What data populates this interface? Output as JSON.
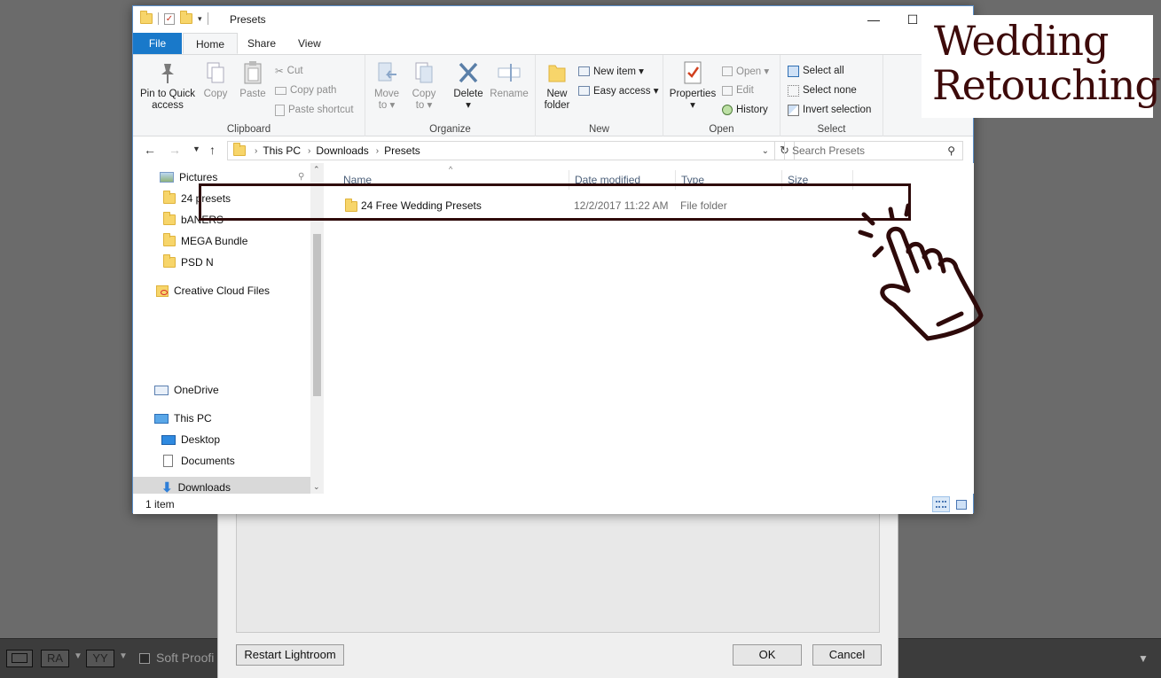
{
  "window": {
    "title": "Presets",
    "minimize_glyph": "—",
    "maximize_glyph": "☐",
    "close_glyph": "✕"
  },
  "ribbon_tabs": [
    "File",
    "Home",
    "Share",
    "View"
  ],
  "clipboard": {
    "pin_label": "Pin to Quick\naccess",
    "copy": "Copy",
    "paste": "Paste",
    "cut": "Cut",
    "copy_path": "Copy path",
    "paste_shortcut": "Paste shortcut",
    "group": "Clipboard"
  },
  "organize": {
    "move_to": "Move\nto ▾",
    "copy_to": "Copy\nto ▾",
    "delete": "Delete\n▾",
    "rename": "Rename",
    "group": "Organize"
  },
  "new_group": {
    "new_folder": "New\nfolder",
    "new_item": "New item ▾",
    "easy_access": "Easy access ▾",
    "group": "New"
  },
  "open_group": {
    "properties": "Properties\n▾",
    "open": "Open ▾",
    "edit": "Edit",
    "history": "History",
    "group": "Open"
  },
  "select_group": {
    "select_all": "Select all",
    "select_none": "Select none",
    "invert_selection": "Invert selection",
    "group": "Select"
  },
  "address": {
    "crumbs": [
      "This PC",
      "Downloads",
      "Presets"
    ],
    "search_placeholder": "Search Presets"
  },
  "nav": {
    "items": [
      {
        "label": "Pictures"
      },
      {
        "label": "24 presets"
      },
      {
        "label": "bANERS"
      },
      {
        "label": "MEGA Bundle"
      },
      {
        "label": "PSD N"
      },
      {
        "label": "Creative Cloud Files"
      },
      {
        "label": "OneDrive"
      },
      {
        "label": "This PC"
      },
      {
        "label": "Desktop"
      },
      {
        "label": "Documents"
      },
      {
        "label": "Downloads"
      }
    ]
  },
  "columns": [
    "Name",
    "Date modified",
    "Type",
    "Size"
  ],
  "files": [
    {
      "name": "24 Free Wedding Presets",
      "date": "12/2/2017 11:22 AM",
      "type": "File folder",
      "size": ""
    }
  ],
  "status": {
    "count": "1 item"
  },
  "logo": {
    "line1": "Wedding",
    "line2": "Retouching"
  },
  "lightroom": {
    "tool1": "RA",
    "tool2": "YY",
    "soft_proofing": "Soft Proofi",
    "restart": "Restart Lightroom",
    "ok": "OK",
    "cancel": "Cancel"
  },
  "colors": {
    "accent": "#1979ca",
    "highlight": "#2e0a0a",
    "logo": "#3d0a0a"
  }
}
